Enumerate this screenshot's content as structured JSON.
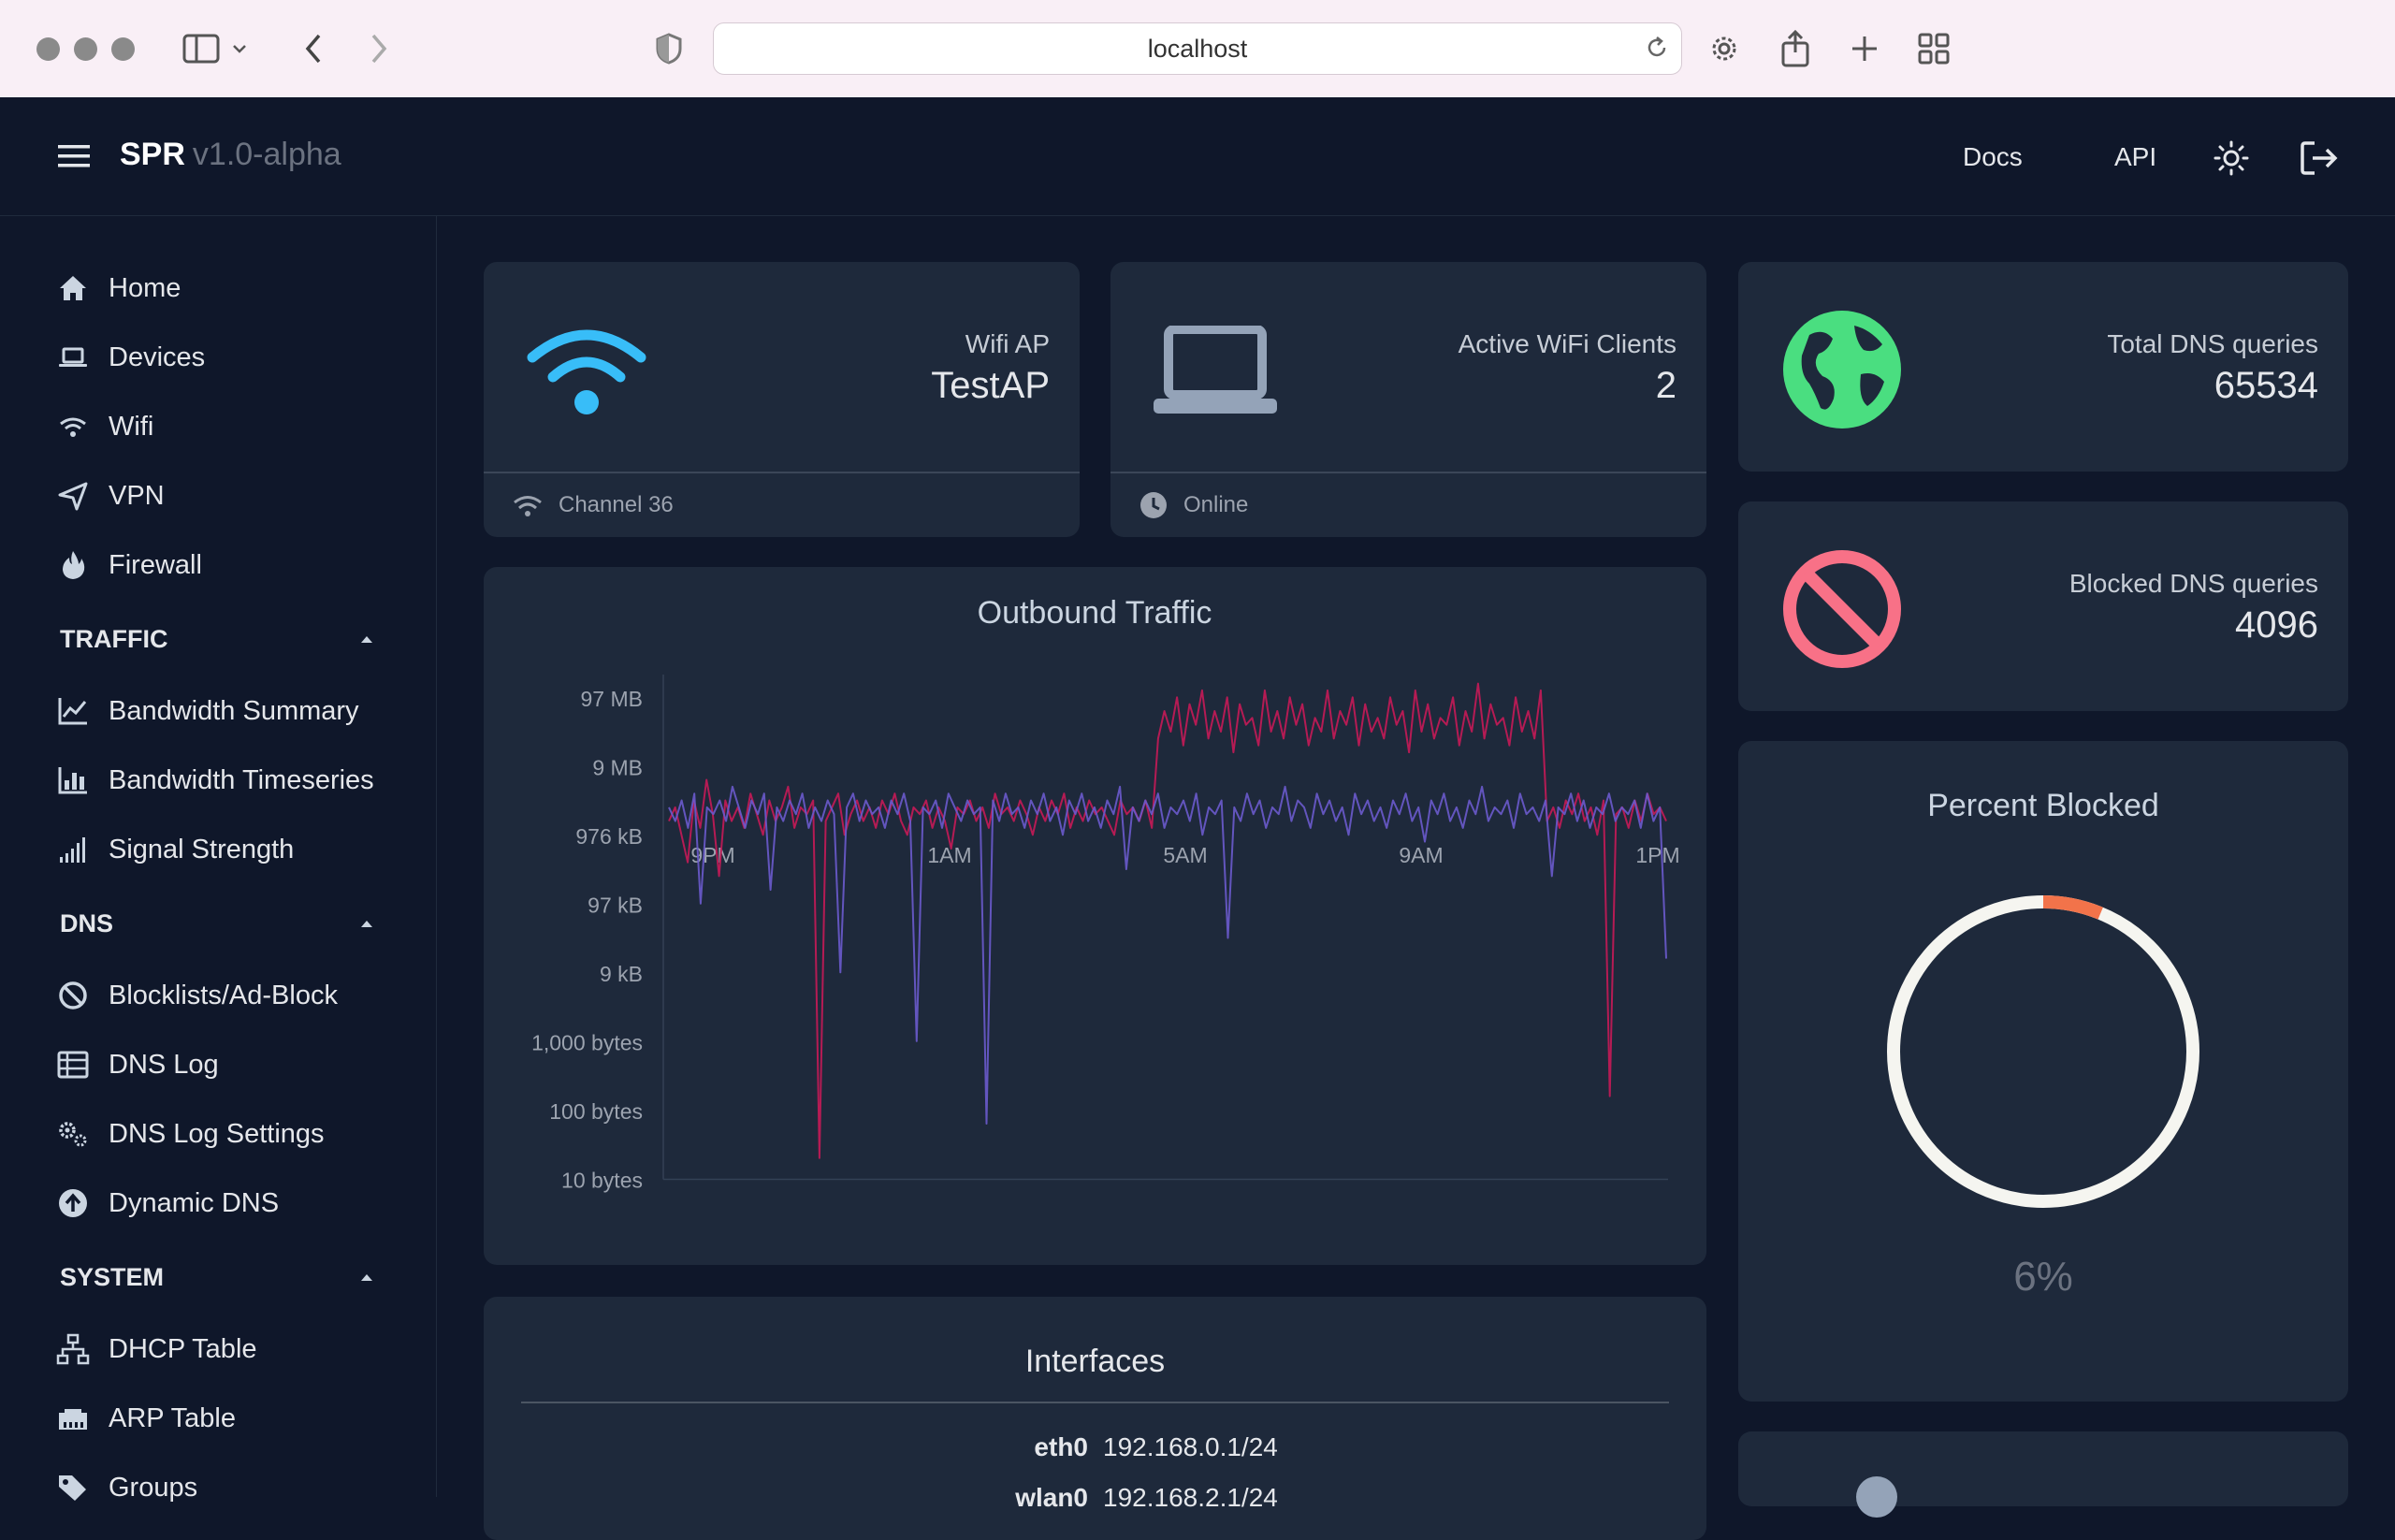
{
  "browser": {
    "url": "localhost"
  },
  "header": {
    "brand": "SPR",
    "version": "v1.0-alpha",
    "links": [
      "Docs",
      "API"
    ]
  },
  "sidebar": {
    "main_items": [
      "Home",
      "Devices",
      "Wifi",
      "VPN",
      "Firewall"
    ],
    "sections": [
      {
        "title": "TRAFFIC",
        "items": [
          "Bandwidth Summary",
          "Bandwidth Timeseries",
          "Signal Strength"
        ]
      },
      {
        "title": "DNS",
        "items": [
          "Blocklists/Ad-Block",
          "DNS Log",
          "DNS Log Settings",
          "Dynamic DNS"
        ]
      },
      {
        "title": "SYSTEM",
        "items": [
          "DHCP Table",
          "ARP Table",
          "Groups"
        ]
      }
    ]
  },
  "cards": {
    "wifi_ap": {
      "label": "Wifi AP",
      "value": "TestAP",
      "footer": "Channel 36"
    },
    "active_clients": {
      "label": "Active WiFi Clients",
      "value": "2",
      "footer": "Online"
    },
    "total_dns": {
      "label": "Total DNS queries",
      "value": "65534"
    },
    "blocked_dns": {
      "label": "Blocked DNS queries",
      "value": "4096"
    },
    "percent_blocked": {
      "title": "Percent Blocked",
      "value": "6%",
      "fraction": 0.0625
    }
  },
  "interfaces": {
    "title": "Interfaces",
    "rows": [
      {
        "name": "eth0",
        "address": "192.168.0.1/24"
      },
      {
        "name": "wlan0",
        "address": "192.168.2.1/24"
      }
    ]
  },
  "colors": {
    "series_red": "#be1a55",
    "series_purple": "#6a5acd",
    "wifi_blue": "#38bdf8",
    "globe_green": "#4ade80",
    "block_red": "#f87187",
    "donut_accent": "#f2734a"
  },
  "chart_data": {
    "type": "line",
    "title": "Outbound Traffic",
    "y_scale": "log",
    "y_ticks": [
      "97 MB",
      "9 MB",
      "976 kB",
      "97 kB",
      "9 kB",
      "1,000 bytes",
      "100 bytes",
      "10 bytes"
    ],
    "x_ticks": [
      "9PM",
      "1AM",
      "5AM",
      "9AM",
      "1PM"
    ],
    "series": [
      {
        "color": "#be1a55",
        "values_log10": [
          6.2,
          6.4,
          6.0,
          5.6,
          6.5,
          6.1,
          6.8,
          6.3,
          5.4,
          6.5,
          6.2,
          6.4,
          6.1,
          6.6,
          6.3,
          6.0,
          6.5,
          6.2,
          6.4,
          6.7,
          6.1,
          6.4,
          6.3,
          6.5,
          1.3,
          6.2,
          6.4,
          6.6,
          6.0,
          6.3,
          6.5,
          6.2,
          6.4,
          6.1,
          6.5,
          6.3,
          6.6,
          6.2,
          6.0,
          6.4,
          6.3,
          6.5,
          6.1,
          6.4,
          6.2,
          5.8,
          6.4,
          6.3,
          6.5,
          6.2,
          6.4,
          6.1,
          6.6,
          6.3,
          6.4,
          6.2,
          6.5,
          6.3,
          6.0,
          6.4,
          6.2,
          6.5,
          6.3,
          6.6,
          6.1,
          6.4,
          6.2,
          6.5,
          6.3,
          6.4,
          6.2,
          6.0,
          6.5,
          6.3,
          6.4,
          6.2,
          6.5,
          6.1,
          7.4,
          7.8,
          7.5,
          8.0,
          7.3,
          7.9,
          7.6,
          8.1,
          7.4,
          7.8,
          7.5,
          8.0,
          7.2,
          7.9,
          7.6,
          7.7,
          7.3,
          8.1,
          7.5,
          7.8,
          7.4,
          8.0,
          7.6,
          7.9,
          7.3,
          7.7,
          7.5,
          8.1,
          7.4,
          7.8,
          7.6,
          8.0,
          7.3,
          7.9,
          7.5,
          7.7,
          7.4,
          8.0,
          7.6,
          7.8,
          7.2,
          8.1,
          7.5,
          7.9,
          7.4,
          7.7,
          7.6,
          8.0,
          7.3,
          7.8,
          7.5,
          8.2,
          7.4,
          7.9,
          7.6,
          7.7,
          7.3,
          8.0,
          7.5,
          7.8,
          7.4,
          8.1,
          6.2,
          6.4,
          6.1,
          6.5,
          6.3,
          6.6,
          6.2,
          6.4,
          6.0,
          6.5,
          2.2,
          6.3,
          6.4,
          6.1,
          6.5,
          6.2,
          6.6,
          6.3,
          6.4,
          6.2
        ]
      },
      {
        "color": "#6a5acd",
        "values_log10": [
          6.4,
          6.2,
          6.5,
          6.1,
          6.6,
          5.0,
          6.4,
          6.3,
          6.5,
          6.2,
          6.7,
          6.4,
          6.1,
          6.5,
          6.3,
          6.6,
          5.2,
          6.4,
          6.2,
          6.5,
          6.3,
          6.6,
          6.1,
          6.4,
          6.2,
          6.5,
          6.3,
          4.0,
          6.4,
          6.6,
          6.2,
          6.5,
          6.3,
          6.4,
          6.1,
          6.5,
          6.3,
          6.6,
          6.2,
          3.0,
          6.4,
          6.3,
          6.5,
          6.1,
          6.6,
          6.4,
          6.2,
          6.5,
          6.3,
          6.4,
          1.8,
          6.5,
          6.2,
          6.6,
          6.3,
          6.4,
          6.1,
          6.5,
          6.3,
          6.6,
          6.2,
          6.4,
          6.0,
          6.5,
          6.3,
          6.6,
          6.2,
          6.4,
          6.1,
          6.5,
          6.3,
          6.7,
          5.5,
          6.4,
          6.2,
          6.5,
          6.3,
          6.6,
          6.1,
          6.4,
          6.3,
          6.5,
          6.2,
          6.6,
          6.0,
          6.4,
          6.3,
          6.5,
          4.5,
          6.4,
          6.2,
          6.6,
          6.3,
          6.5,
          6.1,
          6.4,
          6.3,
          6.7,
          6.2,
          6.5,
          6.4,
          6.1,
          6.6,
          6.3,
          6.5,
          6.2,
          6.4,
          6.0,
          6.6,
          6.3,
          6.5,
          6.2,
          6.4,
          6.1,
          6.5,
          6.3,
          6.6,
          6.2,
          6.4,
          5.9,
          6.5,
          6.3,
          6.6,
          6.2,
          6.4,
          6.1,
          6.5,
          6.3,
          6.7,
          6.2,
          6.4,
          6.3,
          6.5,
          6.1,
          6.6,
          6.3,
          6.4,
          6.2,
          6.5,
          5.4,
          6.4,
          6.3,
          6.6,
          6.2,
          6.5,
          6.1,
          6.4,
          6.3,
          6.6,
          6.2,
          6.4,
          6.3,
          6.5,
          6.1,
          6.6,
          6.2,
          6.4,
          4.2
        ]
      }
    ]
  }
}
